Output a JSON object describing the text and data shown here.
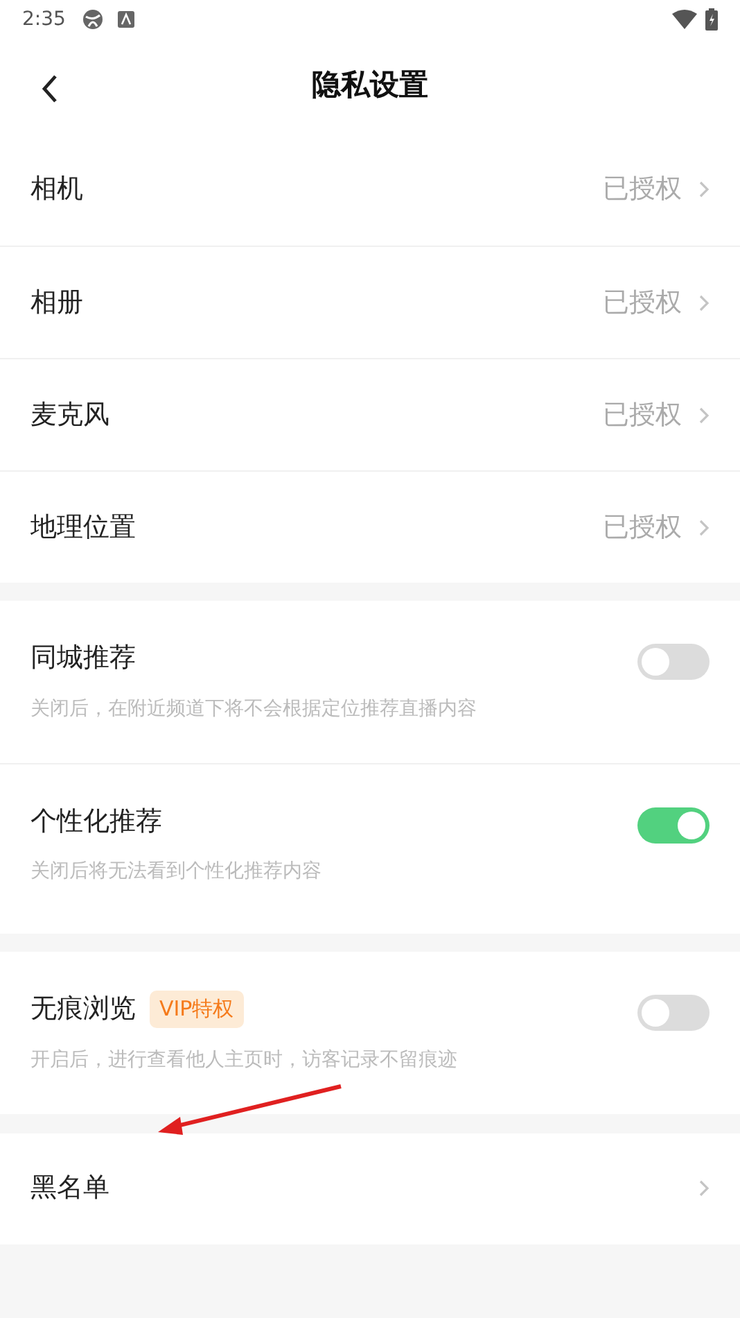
{
  "status_bar": {
    "time": "2:35"
  },
  "header": {
    "title": "隐私设置"
  },
  "permissions": [
    {
      "label": "相机",
      "value": "已授权"
    },
    {
      "label": "相册",
      "value": "已授权"
    },
    {
      "label": "麦克风",
      "value": "已授权"
    },
    {
      "label": "地理位置",
      "value": "已授权"
    }
  ],
  "toggle_groups": [
    [
      {
        "label": "同城推荐",
        "description": "关闭后，在附近频道下将不会根据定位推荐直播内容",
        "on": false
      },
      {
        "label": "个性化推荐",
        "description": "关闭后将无法看到个性化推荐内容",
        "on": true
      }
    ],
    [
      {
        "label": "无痕浏览",
        "badge": "VIP特权",
        "description": "开启后，进行查看他人主页时，访客记录不留痕迹",
        "on": false
      }
    ]
  ],
  "blacklist": {
    "label": "黑名单"
  }
}
